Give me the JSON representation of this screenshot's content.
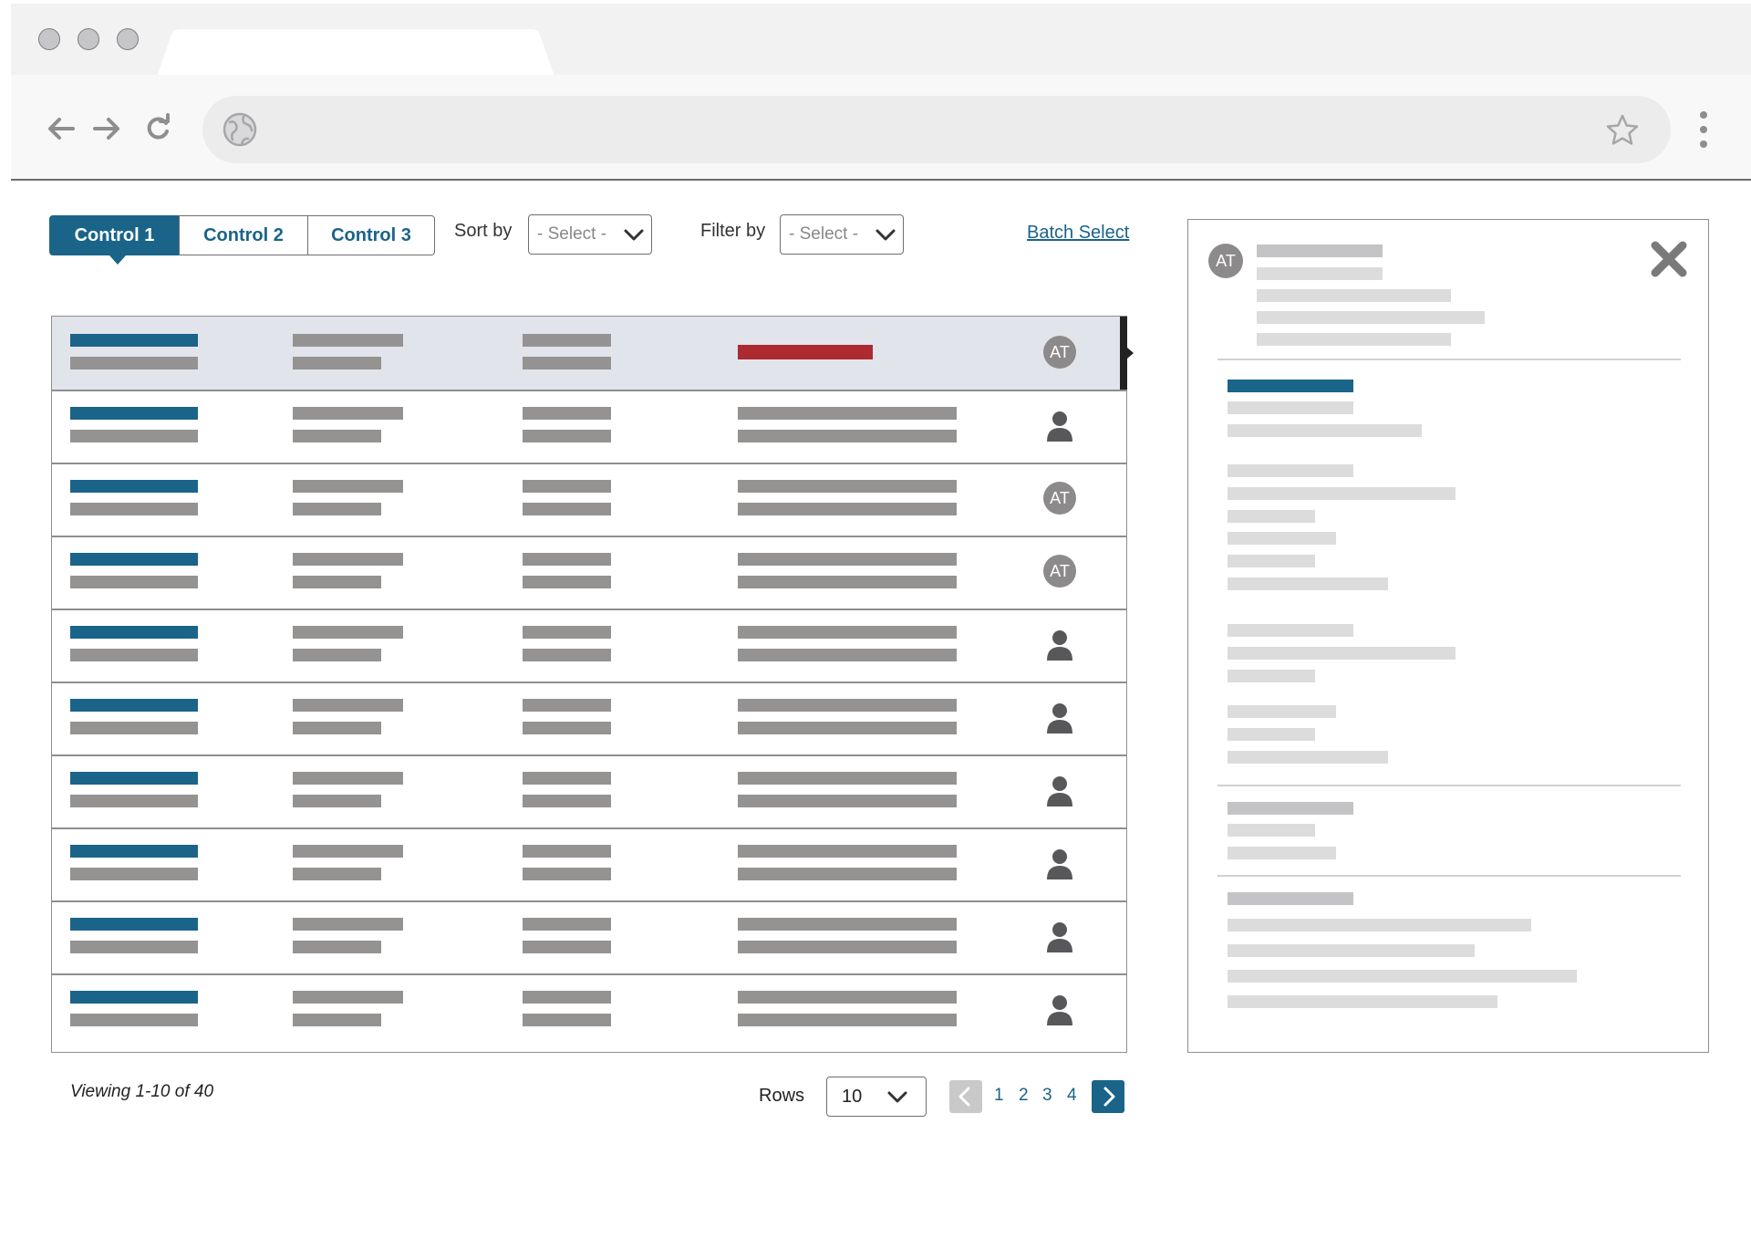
{
  "browser": {
    "address": "",
    "icons": [
      "arrow-left-icon",
      "arrow-right-icon",
      "reload-icon",
      "globe-icon",
      "star-icon",
      "kebab-menu-icon"
    ]
  },
  "controls": {
    "tabs": [
      "Control 1",
      "Control 2",
      "Control 3"
    ],
    "active_tab": "Control 1",
    "sort_label": "Sort by",
    "sort_value": "- Select -",
    "filter_label": "Filter by",
    "filter_value": "- Select -",
    "batch_select": "Batch Select"
  },
  "table": {
    "rows": [
      {
        "selected": true,
        "status": "red",
        "owner": "AT"
      },
      {
        "selected": false,
        "status": "normal",
        "owner": "person-icon"
      },
      {
        "selected": false,
        "status": "normal",
        "owner": "AT"
      },
      {
        "selected": false,
        "status": "normal",
        "owner": "AT"
      },
      {
        "selected": false,
        "status": "normal",
        "owner": "person-icon"
      },
      {
        "selected": false,
        "status": "normal",
        "owner": "person-icon"
      },
      {
        "selected": false,
        "status": "normal",
        "owner": "person-icon"
      },
      {
        "selected": false,
        "status": "normal",
        "owner": "person-icon"
      },
      {
        "selected": false,
        "status": "normal",
        "owner": "person-icon"
      },
      {
        "selected": false,
        "status": "normal",
        "owner": "person-icon"
      }
    ]
  },
  "footer": {
    "viewing": "Viewing 1-10 of 40",
    "rows_label": "Rows",
    "rows_value": "10",
    "pages": [
      "1",
      "2",
      "3",
      "4"
    ]
  },
  "panel": {
    "avatar": "AT",
    "close_icon": "close-icon"
  },
  "colors": {
    "accent": "#1a6489",
    "alert": "#ac2a30",
    "placeholder_bar": "#959292",
    "selected_row": "#e2e4ec"
  }
}
